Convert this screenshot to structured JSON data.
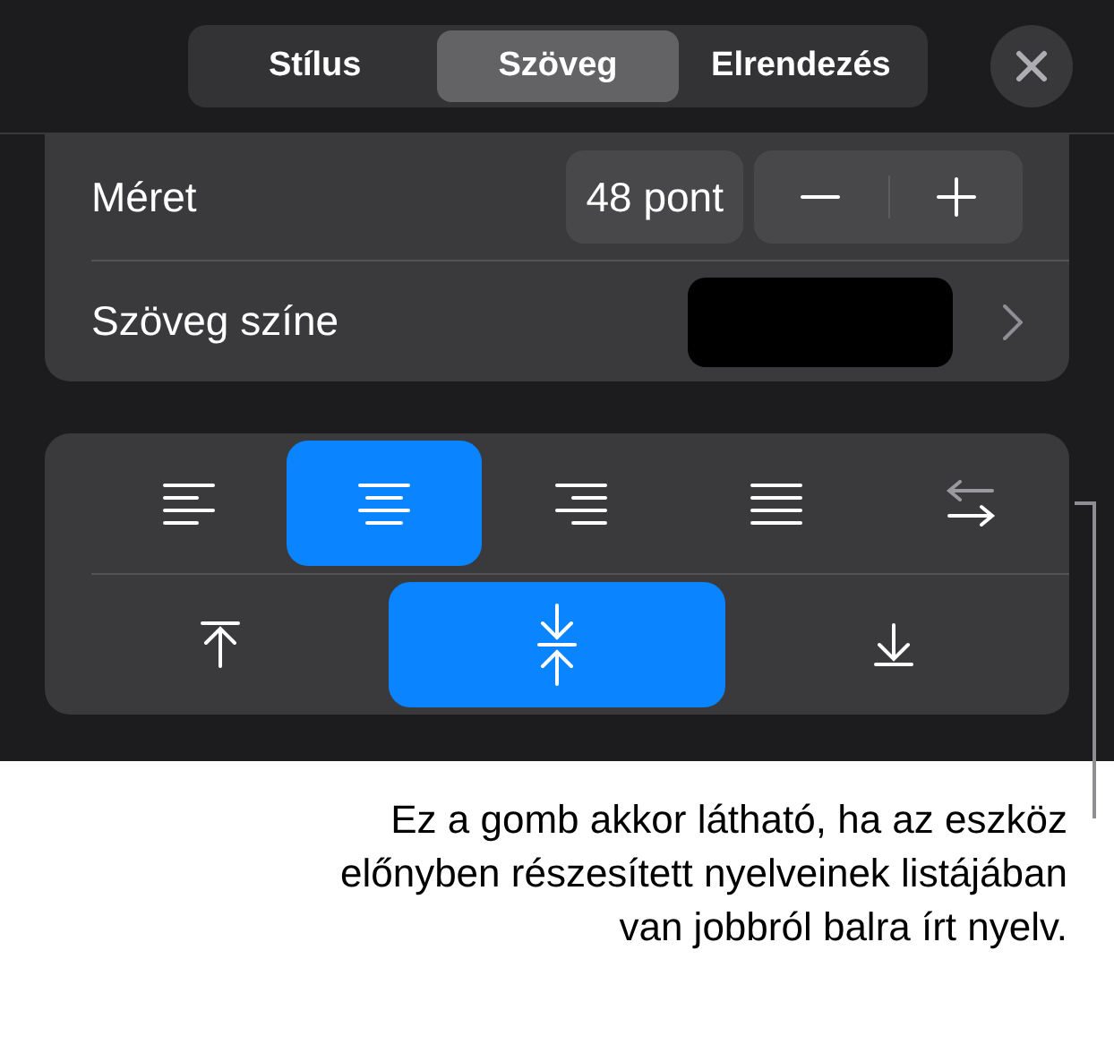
{
  "tabs": [
    {
      "label": "Stílus",
      "selected": false
    },
    {
      "label": "Szöveg",
      "selected": true
    },
    {
      "label": "Elrendezés",
      "selected": false
    }
  ],
  "size_row": {
    "label": "Méret",
    "value": "48 pont"
  },
  "color_row": {
    "label": "Szöveg színe",
    "color": "#000000"
  },
  "horizontal_alignment": [
    {
      "kind": "left",
      "selected": false
    },
    {
      "kind": "center",
      "selected": true
    },
    {
      "kind": "right",
      "selected": false
    },
    {
      "kind": "justify",
      "selected": false
    },
    {
      "kind": "direction",
      "selected": false
    }
  ],
  "vertical_alignment": [
    {
      "kind": "top",
      "selected": false
    },
    {
      "kind": "middle",
      "selected": true
    },
    {
      "kind": "bottom",
      "selected": false
    }
  ],
  "callout": "Ez a gomb akkor látható, ha az eszköz előnyben részesített nyelveinek listájában van jobbról balra írt nyelv."
}
